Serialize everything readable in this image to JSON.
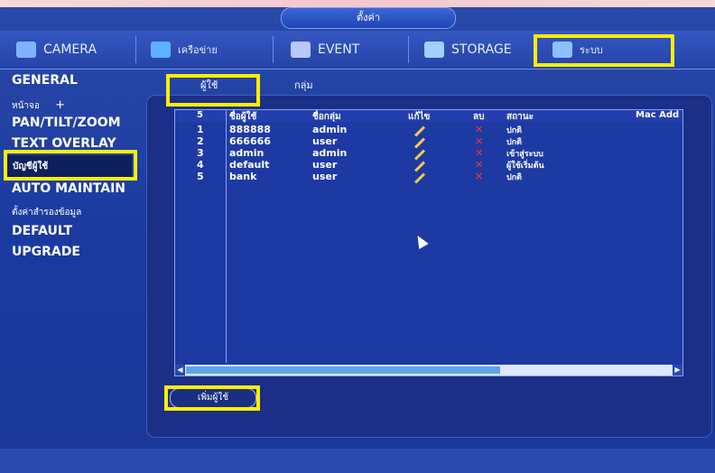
{
  "window": {
    "title": "ตั้งค่า"
  },
  "tabs": [
    {
      "label": "CAMERA",
      "icon": "camera-icon"
    },
    {
      "label": "เครือข่าย",
      "icon": "network-icon"
    },
    {
      "label": "EVENT",
      "icon": "event-icon"
    },
    {
      "label": "STORAGE",
      "icon": "storage-icon"
    },
    {
      "label": "ระบบ",
      "icon": "system-icon",
      "selected": true
    }
  ],
  "sidebar": {
    "items": [
      {
        "label": "GENERAL"
      },
      {
        "label": "หน้าจอ"
      },
      {
        "label": "PAN/TILT/ZOOM"
      },
      {
        "label": "TEXT OVERLAY"
      },
      {
        "label": "บัญชีผู้ใช้",
        "selected": true
      },
      {
        "label": "AUTO MAINTAIN"
      },
      {
        "label": "ตั้งค่าสำรองข้อมูล"
      },
      {
        "label": "DEFAULT"
      },
      {
        "label": "UPGRADE"
      }
    ]
  },
  "subtabs": [
    {
      "label": "ผู้ใช้",
      "selected": true
    },
    {
      "label": "กลุ่ม"
    }
  ],
  "table": {
    "count": "5",
    "columns": [
      "ชื่อผู้ใช้",
      "ชื่อกลุ่ม",
      "แก้ไข",
      "ลบ",
      "สถานะ",
      "Mac Add"
    ],
    "rows": [
      {
        "num": "1",
        "user": "888888",
        "group": "admin",
        "status": "ปกติ"
      },
      {
        "num": "2",
        "user": "666666",
        "group": "user",
        "status": "ปกติ"
      },
      {
        "num": "3",
        "user": "admin",
        "group": "admin",
        "status": "เข้าสู่ระบบ"
      },
      {
        "num": "4",
        "user": "default",
        "group": "user",
        "status": "ผู้ใช้เริ่มต้น"
      },
      {
        "num": "5",
        "user": "bank",
        "group": "user",
        "status": "ปกติ"
      }
    ]
  },
  "add_user_button": "เพิ่มผู้ใช้",
  "colors": {
    "highlight": "#ffee00",
    "accent": "#1b3aa0",
    "delete": "#ff3030",
    "edit": "#f2c94c"
  }
}
